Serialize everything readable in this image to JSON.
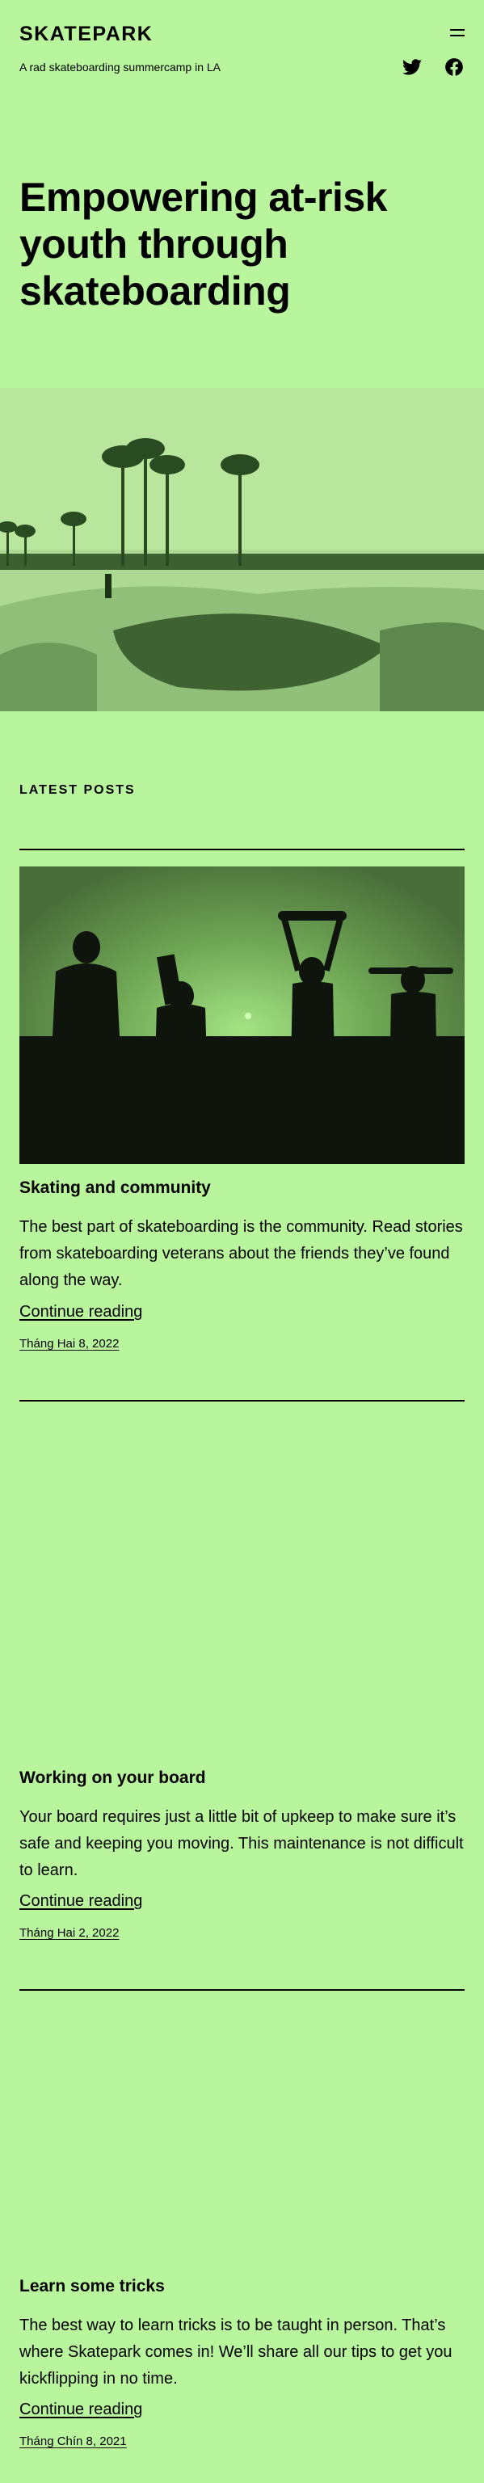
{
  "site": {
    "title": "SKATEPARK",
    "tagline": "A rad skateboarding summercamp in LA"
  },
  "header": {
    "menu_icon": "hamburger-menu-icon",
    "social": [
      {
        "icon": "twitter-icon"
      },
      {
        "icon": "facebook-icon"
      }
    ]
  },
  "hero": {
    "heading": "Empowering at-risk youth through skateboarding"
  },
  "latest": {
    "heading": "LATEST POSTS"
  },
  "posts": [
    {
      "title": "Skating and community",
      "excerpt": "The best part of skateboarding is the community. Read stories from skateboarding veterans about the friends they’ve found along the way.",
      "link": "Continue reading",
      "date": "Tháng Hai 8, 2022"
    },
    {
      "title": "Working on your board",
      "excerpt": "Your board requires just a little bit of upkeep to make sure it’s safe and keeping you moving. This maintenance is not difficult to learn.",
      "link": "Continue reading",
      "date": "Tháng Hai 2, 2022"
    },
    {
      "title": "Learn some tricks",
      "excerpt": "The best way to learn tricks is to be taught in person. That’s where Skatepark comes in! We’ll share all our tips to get you kickflipping in no time.",
      "link": "Continue reading",
      "date": "Tháng Chín 8, 2021"
    }
  ],
  "colors": {
    "background": "#b8f59c",
    "text": "#000000"
  }
}
